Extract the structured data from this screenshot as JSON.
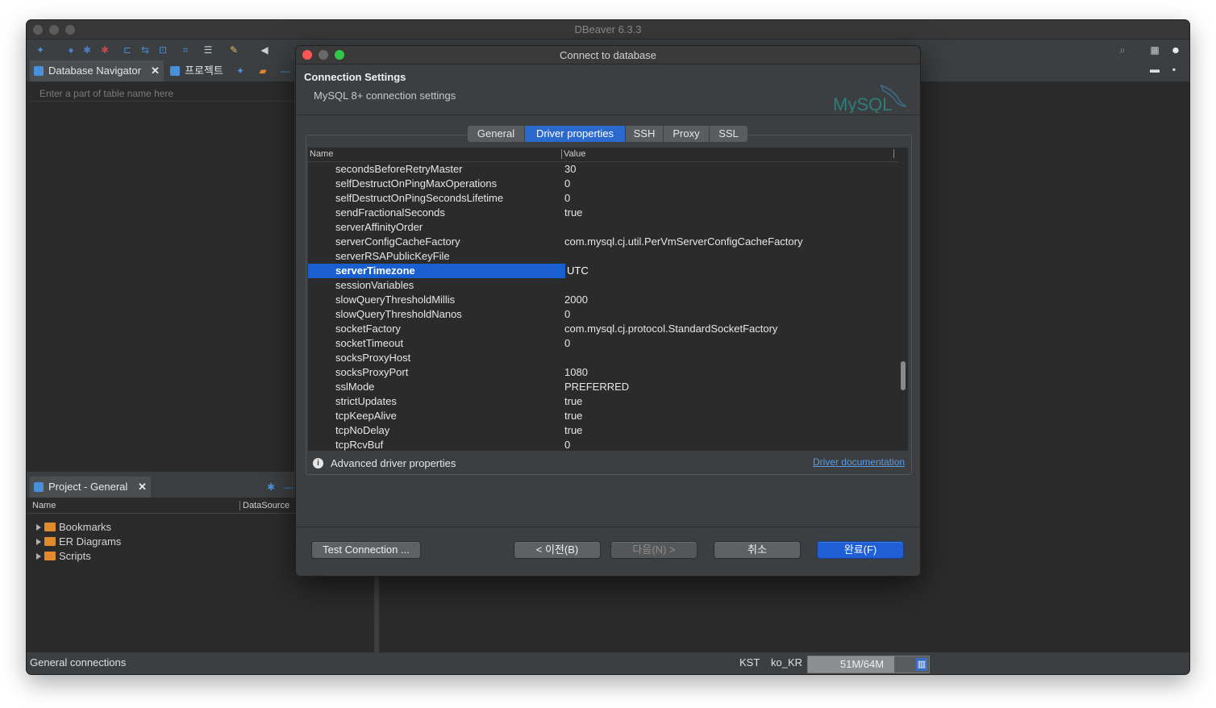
{
  "app": {
    "title": "DBeaver 6.3.3",
    "colors": {
      "selection": "#1a5fd0",
      "primary_button": "#1e5fd6",
      "link": "#5a9be6",
      "folder": "#e08a2e"
    }
  },
  "navigator": {
    "tabs": [
      {
        "label": "Database Navigator"
      },
      {
        "label": "프로젝트"
      }
    ],
    "search_placeholder": "Enter a part of table name here"
  },
  "project": {
    "tab_label": "Project - General",
    "columns": [
      "Name",
      "DataSource"
    ],
    "items": [
      {
        "label": "Bookmarks",
        "icon": "bookmark-folder-icon"
      },
      {
        "label": "ER Diagrams",
        "icon": "er-diagram-folder-icon"
      },
      {
        "label": "Scripts",
        "icon": "scripts-folder-icon"
      }
    ]
  },
  "statusbar": {
    "left": "General connections",
    "timezone": "KST",
    "locale": "ko_KR",
    "memory": "51M/64M",
    "memory_used_fraction": 0.8
  },
  "dialog": {
    "title": "Connect to database",
    "heading": "Connection Settings",
    "subheading": "MySQL 8+ connection settings",
    "logo_text": "MySQL",
    "tabs": [
      {
        "label": "General"
      },
      {
        "label": "Driver properties",
        "active": true
      },
      {
        "label": "SSH"
      },
      {
        "label": "Proxy"
      },
      {
        "label": "SSL"
      }
    ],
    "grid_columns": [
      "Name",
      "Value"
    ],
    "properties": [
      {
        "name": "secondsBeforeRetryMaster",
        "value": "30"
      },
      {
        "name": "selfDestructOnPingMaxOperations",
        "value": "0"
      },
      {
        "name": "selfDestructOnPingSecondsLifetime",
        "value": "0"
      },
      {
        "name": "sendFractionalSeconds",
        "value": "true"
      },
      {
        "name": "serverAffinityOrder",
        "value": ""
      },
      {
        "name": "serverConfigCacheFactory",
        "value": "com.mysql.cj.util.PerVmServerConfigCacheFactory"
      },
      {
        "name": "serverRSAPublicKeyFile",
        "value": ""
      },
      {
        "name": "serverTimezone",
        "value": "UTC",
        "selected": true
      },
      {
        "name": "sessionVariables",
        "value": ""
      },
      {
        "name": "slowQueryThresholdMillis",
        "value": "2000"
      },
      {
        "name": "slowQueryThresholdNanos",
        "value": "0"
      },
      {
        "name": "socketFactory",
        "value": "com.mysql.cj.protocol.StandardSocketFactory"
      },
      {
        "name": "socketTimeout",
        "value": "0"
      },
      {
        "name": "socksProxyHost",
        "value": ""
      },
      {
        "name": "socksProxyPort",
        "value": "1080"
      },
      {
        "name": "sslMode",
        "value": "PREFERRED"
      },
      {
        "name": "strictUpdates",
        "value": "true"
      },
      {
        "name": "tcpKeepAlive",
        "value": "true"
      },
      {
        "name": "tcpNoDelay",
        "value": "true"
      },
      {
        "name": "tcpRcvBuf",
        "value": "0"
      }
    ],
    "info_text": "Advanced driver properties",
    "doc_link": "Driver documentation",
    "buttons": {
      "test": "Test Connection ...",
      "back": "< 이전(B)",
      "next": "다음(N) >",
      "cancel": "취소",
      "finish": "완료(F)"
    }
  }
}
